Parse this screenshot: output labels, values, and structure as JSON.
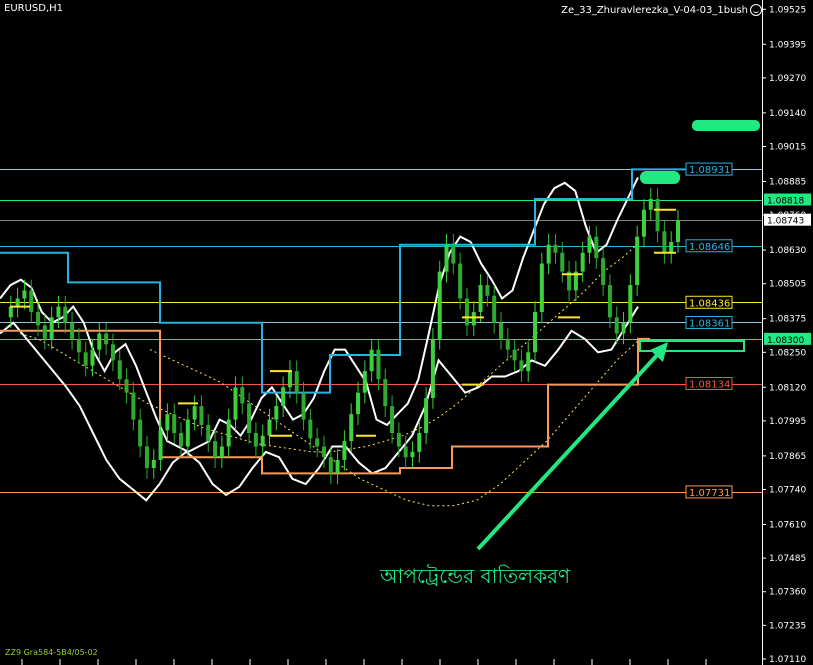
{
  "header": {
    "symbol": "EURUSD,H1",
    "indicator": "Ze_33_Zhuravlerezka_V-04-03_1bush"
  },
  "footer": {
    "text": "ZZ9 Gra584-5B4/05-02"
  },
  "annotation": {
    "text": "আপট্রেন্ডের বাতিলকরণ",
    "color": "#22e882"
  },
  "colors": {
    "bg": "#000000",
    "axis": "#ffffff",
    "bull": "#3ed13e",
    "bear": "#2eaa2e",
    "bands": "#ffffff",
    "stepline_blue": "#2ab2e0",
    "stepline_orange": "#f79a5a",
    "signal": "#ffe62a",
    "ma_dots": "#ffe640",
    "highlight": "#22e882"
  },
  "chart_data": {
    "type": "candlestick",
    "y_axis": {
      "min": 1.0711,
      "max": 1.09541,
      "ticks": [
        "1.09525",
        "1.09395",
        "1.09270",
        "1.09140",
        "1.09015",
        "1.08885",
        "1.08760",
        "1.08630",
        "1.08505",
        "1.08375",
        "1.08250",
        "1.08120",
        "1.07995",
        "1.07865",
        "1.07740",
        "1.07610",
        "1.07485",
        "1.07360",
        "1.07235",
        "1.07110"
      ]
    },
    "price_labels": [
      {
        "value": "1.08931",
        "color": "#2ab2e0",
        "style": "box"
      },
      {
        "value": "1.08818",
        "color": "#22e882",
        "style": "fill"
      },
      {
        "value": "1.08743",
        "color": "#ffffff",
        "style": "current"
      },
      {
        "value": "1.08646",
        "color": "#2ab2e0",
        "style": "box"
      },
      {
        "value": "1.08436",
        "color": "#ffe62a",
        "style": "box"
      },
      {
        "value": "1.08361",
        "color": "#2ab2e0",
        "style": "box"
      },
      {
        "value": "1.08300",
        "color": "#22e882",
        "style": "fill"
      },
      {
        "value": "1.08134",
        "color": "#f4564a",
        "style": "box"
      },
      {
        "value": "1.07731",
        "color": "#f79a5a",
        "style": "box"
      }
    ],
    "hlines": [
      {
        "value": 1.08931,
        "color": "#8fc6dc"
      },
      {
        "value": 1.08818,
        "color": "#22e882"
      },
      {
        "value": 1.08743,
        "color": "#7f7f7f"
      },
      {
        "value": 1.08646,
        "color": "#2ab2e0"
      },
      {
        "value": 1.08436,
        "color": "#ffe62a"
      },
      {
        "value": 1.08361,
        "color": "#8fc6dc"
      },
      {
        "value": 1.083,
        "color": "#22e882"
      },
      {
        "value": 1.08134,
        "color": "#f4564a"
      },
      {
        "value": 1.07731,
        "color": "#f79a5a"
      }
    ],
    "close": [
      1.0838,
      1.0842,
      1.0845,
      1.0848,
      1.084,
      1.0835,
      1.083,
      1.0838,
      1.0842,
      1.0836,
      1.083,
      1.0825,
      1.082,
      1.0826,
      1.0832,
      1.0828,
      1.0822,
      1.0815,
      1.081,
      1.08,
      1.079,
      1.0782,
      1.0785,
      1.0796,
      1.0802,
      1.0795,
      1.079,
      1.08,
      1.0805,
      1.0798,
      1.0792,
      1.0786,
      1.079,
      1.08,
      1.0812,
      1.0806,
      1.0795,
      1.079,
      1.0794,
      1.08,
      1.0805,
      1.0812,
      1.0818,
      1.081,
      1.08,
      1.0793,
      1.079,
      1.0786,
      1.078,
      1.0785,
      1.0792,
      1.0802,
      1.081,
      1.0818,
      1.0826,
      1.0815,
      1.0805,
      1.0795,
      1.079,
      1.0786,
      1.0788,
      1.0795,
      1.0808,
      1.083,
      1.0855,
      1.0865,
      1.0858,
      1.0845,
      1.0835,
      1.084,
      1.085,
      1.0846,
      1.0836,
      1.083,
      1.0826,
      1.0822,
      1.0818,
      1.0825,
      1.084,
      1.0858,
      1.0865,
      1.0862,
      1.0855,
      1.0848,
      1.0855,
      1.0862,
      1.0868,
      1.086,
      1.085,
      1.0838,
      1.0832,
      1.0836,
      1.085,
      1.0868,
      1.0878,
      1.0882,
      1.087,
      1.0862,
      1.0866,
      1.0874
    ],
    "channel_upper": [
      1.0845,
      1.085,
      1.0852,
      1.0849,
      1.084,
      1.0836,
      1.0838,
      1.0842,
      1.0836,
      1.0825,
      1.0818,
      1.0825,
      1.0828,
      1.082,
      1.081,
      1.08,
      1.0792,
      1.079,
      1.0788,
      1.079,
      1.0792,
      1.08,
      1.0798,
      1.0794,
      1.08,
      1.0808,
      1.0812,
      1.0806,
      1.08,
      1.0802,
      1.0808,
      1.0818,
      1.0826,
      1.0826,
      1.082,
      1.0814,
      1.08,
      1.0798,
      1.0802,
      1.0806,
      1.0815,
      1.0832,
      1.085,
      1.0862,
      1.0868,
      1.0866,
      1.0858,
      1.0852,
      1.0845,
      1.0848,
      1.086,
      1.087,
      1.088,
      1.0886,
      1.0888,
      1.0885,
      1.0872,
      1.0862,
      1.0865,
      1.0874,
      1.0882,
      1.089
    ],
    "channel_lower": [
      1.0832,
      1.0836,
      1.083,
      1.0824,
      1.0818,
      1.0812,
      1.0805,
      1.0795,
      1.0785,
      1.0778,
      1.0774,
      1.077,
      1.0776,
      1.0784,
      1.0788,
      1.0784,
      1.0776,
      1.0772,
      1.0775,
      1.0782,
      1.0788,
      1.0786,
      1.0778,
      1.0776,
      1.0782,
      1.079,
      1.079,
      1.0784,
      1.078,
      1.0782,
      1.0788,
      1.0794,
      1.0805,
      1.0822,
      1.0816,
      1.081,
      1.0812,
      1.0816,
      1.0816,
      1.0818,
      1.0822,
      1.082,
      1.0826,
      1.0833,
      1.083,
      1.0825,
      1.0826,
      1.0834,
      1.0842
    ],
    "ma_slow": [
      1.0832,
      1.083,
      1.0826,
      1.0822,
      1.0818,
      1.0814,
      1.081,
      1.0806,
      1.0803,
      1.08,
      1.0797,
      1.0795,
      1.0793,
      1.0791,
      1.079,
      1.0789,
      1.0788,
      1.0788,
      1.0789,
      1.079,
      1.0792,
      1.0794,
      1.0797,
      1.0801,
      1.0806,
      1.0812,
      1.0818,
      1.0824,
      1.083,
      1.0836,
      1.0842,
      1.0848,
      1.0855,
      1.086,
      1.0866
    ],
    "ma_lower": [
      1.0826,
      1.0822,
      1.0818,
      1.0814,
      1.0808,
      1.0802,
      1.0796,
      1.079,
      1.0784,
      1.0778,
      1.0774,
      1.077,
      1.0768,
      1.0768,
      1.077,
      1.0776,
      1.0784,
      1.0792,
      1.0802,
      1.0812,
      1.0822,
      1.083
    ]
  }
}
